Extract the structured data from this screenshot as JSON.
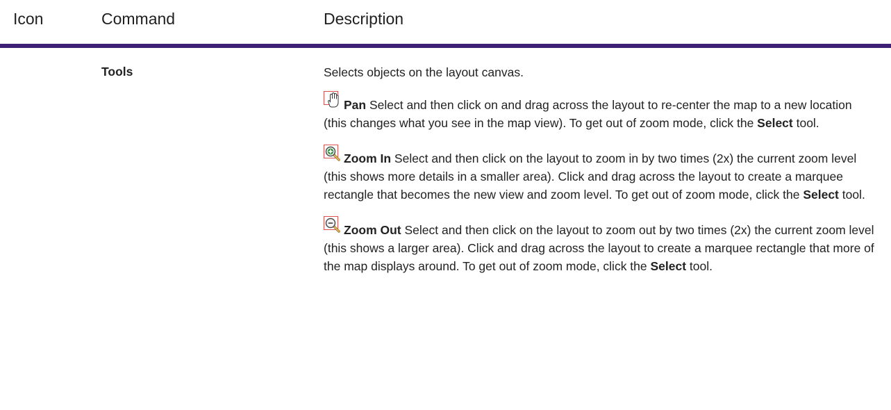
{
  "table": {
    "headers": {
      "icon": "Icon",
      "command": "Command",
      "description": "Description"
    },
    "colors": {
      "header_rule": "#3e1f73",
      "text": "#222222"
    }
  },
  "row": {
    "command": "Tools",
    "intro": "Selects objects on the layout canvas.",
    "items": [
      {
        "icon": "pan-hand-icon",
        "name": "Pan",
        "text_before": " Select and then click on and drag across the layout to re-center the map to a new location (this changes what you see in the map view). To get out of zoom mode, click the ",
        "bold_link": "Select",
        "text_after": " tool."
      },
      {
        "icon": "zoom-in-icon",
        "name": "Zoom In",
        "text_before": " Select and then click on the layout to zoom in by two times (2x) the current zoom level (this shows more details in a smaller area). Click and drag across the layout to create a marquee rectangle that becomes the new view and zoom level. To get out of zoom mode, click the ",
        "bold_link": "Select",
        "text_after": " tool."
      },
      {
        "icon": "zoom-out-icon",
        "name": "Zoom Out",
        "text_before": " Select and then click on the layout to zoom out by two times (2x) the current zoom level (this shows a larger area). Click and drag across the layout to create a marquee rectangle that more of the map displays around. To get out of zoom mode, click the ",
        "bold_link": "Select",
        "text_after": " tool."
      }
    ]
  }
}
